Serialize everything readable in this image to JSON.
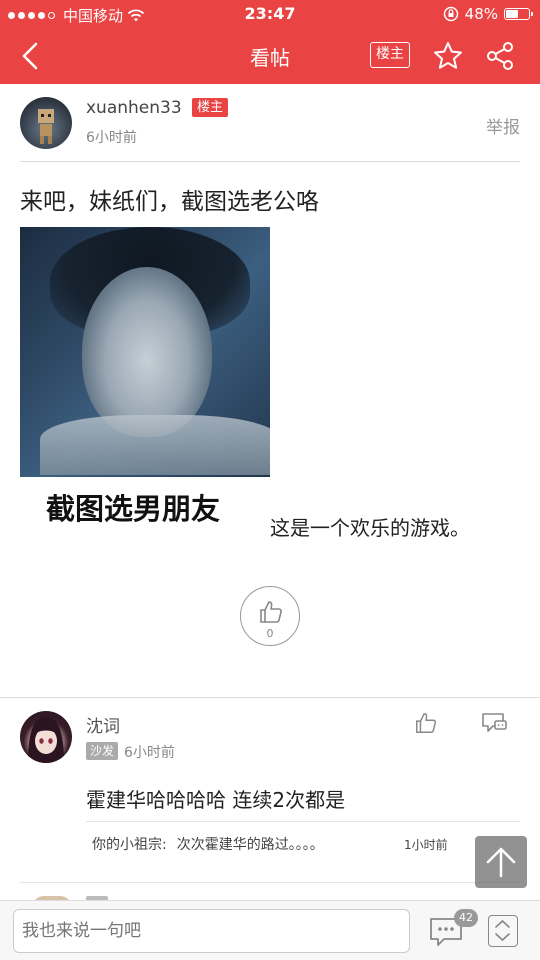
{
  "status_bar": {
    "carrier": "中国移动",
    "time": "23:47",
    "battery": "48%",
    "battery_level": 0.48
  },
  "nav": {
    "title": "看帖",
    "louzhu_button": "楼主"
  },
  "post": {
    "author": "xuanhen33",
    "author_tag": "楼主",
    "time": "6小时前",
    "report": "举报",
    "title": "来吧，妹纸们，截图选老公咯",
    "caption_big": "截图选男朋友",
    "caption_small": "这是一个欢乐的游戏。",
    "like_count": "0"
  },
  "comments": [
    {
      "author": "沈词",
      "badge": "沙发",
      "time": "6小时前",
      "text": "霍建华哈哈哈哈 连续2次都是",
      "replies": [
        {
          "author": "你的小祖宗:",
          "text": "次次霍建华的路过。。。。",
          "time": "1小时前"
        }
      ]
    }
  ],
  "input": {
    "placeholder": "我也来说一句吧",
    "comment_count": "42"
  },
  "colors": {
    "brand_red": "#e94343"
  }
}
